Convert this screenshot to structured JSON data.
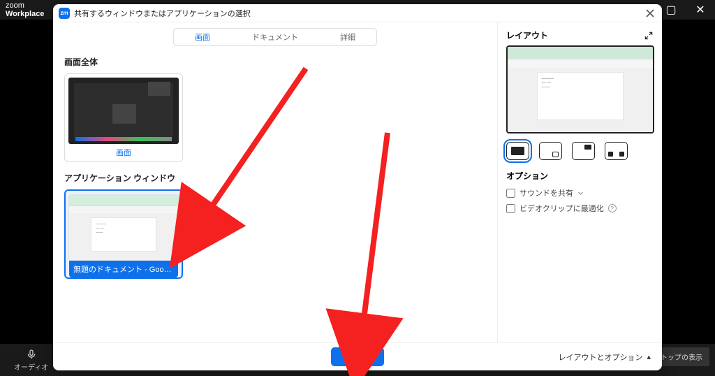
{
  "background": {
    "brand_top": "zoom",
    "brand_bottom": "Workplace",
    "audio_label": "オーディオ",
    "desktop_hint": "デスクトップの表示"
  },
  "modal": {
    "title": "共有するウィンドウまたはアプリケーションの選択",
    "tabs": [
      {
        "label": "画面",
        "active": true
      },
      {
        "label": "ドキュメント",
        "active": false
      },
      {
        "label": "詳細",
        "active": false
      }
    ],
    "section_full": "画面全体",
    "screen_thumb_label": "画面",
    "section_app": "アプリケーション ウィンドウ",
    "app_thumb_label": "無題のドキュメント - Google ドキュメント -...",
    "layout": {
      "title": "レイアウト",
      "options_title": "オプション",
      "share_sound": "サウンドを共有",
      "video_opt": "ビデオクリップに最適化"
    },
    "footer": {
      "share": "共有",
      "layout_btn": "レイアウトとオプション"
    }
  }
}
